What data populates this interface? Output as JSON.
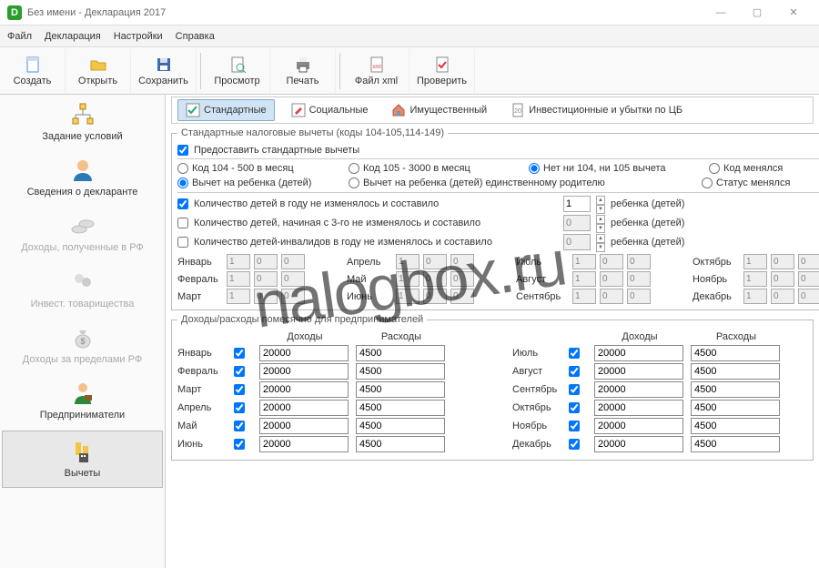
{
  "window": {
    "title": "Без имени - Декларация 2017"
  },
  "menu": {
    "file": "Файл",
    "decl": "Декларация",
    "settings": "Настройки",
    "help": "Справка"
  },
  "toolbar": {
    "create": "Создать",
    "open": "Открыть",
    "save": "Сохранить",
    "preview": "Просмотр",
    "print": "Печать",
    "filexml": "Файл xml",
    "check": "Проверить"
  },
  "sidebar": {
    "cond": "Задание условий",
    "declarant": "Сведения о декларанте",
    "incomeRF": "Доходы, полученные в РФ",
    "invest": "Инвест. товарищества",
    "incomeAbroad": "Доходы за пределами РФ",
    "entrepreneur": "Предприниматели",
    "deductions": "Вычеты"
  },
  "tabs": {
    "standard": "Стандартные",
    "social": "Социальные",
    "property": "Имущественный",
    "investLoss": "Инвестиционные и убытки по ЦБ"
  },
  "group": {
    "legend": "Стандартные налоговые вычеты (коды 104-105,114-149)",
    "provide": "Предоставить стандартные вычеты",
    "r104": "Код 104 - 500 в месяц",
    "r105": "Код 105 - 3000 в месяц",
    "rNone": "Нет ни 104, ни 105 вычета",
    "rCodeChanged": "Код менялся",
    "rChild": "Вычет на ребенка (детей)",
    "rChildSingle": "Вычет на ребенка (детей) единственному родителю",
    "rStatusChanged": "Статус менялся",
    "childCount": "Количество детей в году не изменялось и составило",
    "childCount3": "Количество детей, начиная с 3-го не изменялось и составило",
    "childInvalid": "Количество детей-инвалидов в году не изменялось и составило",
    "childUnit": "ребенка (детей)",
    "val1": "1",
    "val0": "0"
  },
  "months": {
    "jan": "Январь",
    "feb": "Февраль",
    "mar": "Март",
    "apr": "Апрель",
    "may": "Май",
    "jun": "Июнь",
    "jul": "Июль",
    "aug": "Август",
    "sep": "Сентябрь",
    "oct": "Октябрь",
    "nov": "Ноябрь",
    "dec": "Декабрь",
    "v1": "1",
    "v0": "0"
  },
  "biz": {
    "legend": "Доходы/расходы помесячно для предпринимателей",
    "income": "Доходы",
    "expense": "Расходы",
    "incVal": "20000",
    "expVal": "4500"
  },
  "watermark": "nalogbox.ru"
}
